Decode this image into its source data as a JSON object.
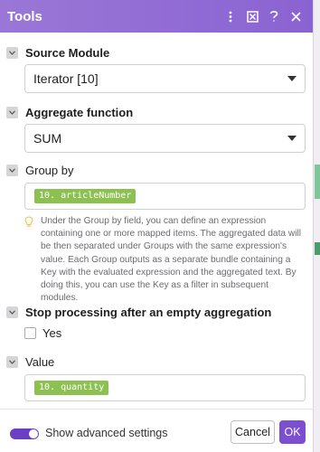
{
  "header": {
    "title": "Tools",
    "icons": [
      "more-vertical-icon",
      "expand-icon",
      "help-icon",
      "close-icon"
    ],
    "color": "#8a63d2"
  },
  "sections": {
    "source_module": {
      "label": "Source Module",
      "value": "Iterator [10]"
    },
    "aggregate_function": {
      "label": "Aggregate function",
      "value": "SUM"
    },
    "group_by": {
      "label": "Group by",
      "token": "10. articleNumber",
      "hint": "Under the Group by field, you can define an expression containing one or more mapped items. The aggregated data will be then separated under Groups with the same expression's value. Each Group outputs as a separate bundle containing a Key with the evaluated expression and the aggregated text. By doing this, you can use the Key as a filter in subsequent modules."
    },
    "stop_processing": {
      "label": "Stop processing after an empty aggregation",
      "option_label": "Yes",
      "checked": false
    },
    "value": {
      "label": "Value",
      "token": "10. quantity"
    }
  },
  "footer": {
    "advanced_label": "Show advanced settings",
    "advanced_on": true,
    "cancel_label": "Cancel",
    "ok_label": "OK"
  },
  "colors": {
    "accent": "#7b4fd0",
    "token_green": "#8cc152"
  }
}
